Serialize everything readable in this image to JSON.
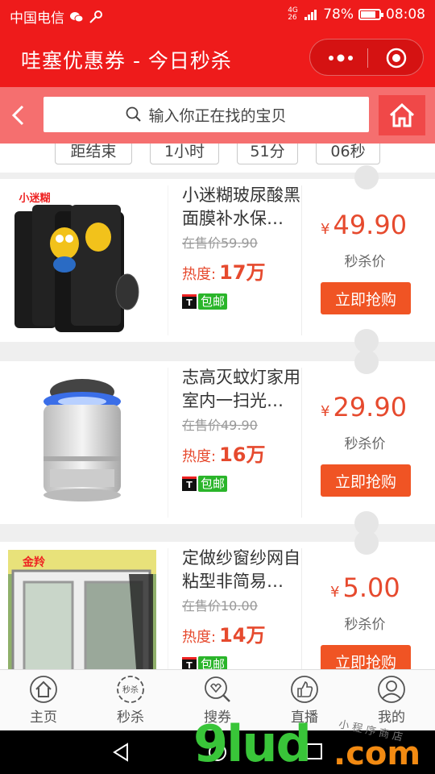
{
  "status_bar": {
    "carrier": "中国电信",
    "network": "4G 26",
    "battery": "78%",
    "time": "08:08"
  },
  "header": {
    "title": "哇塞优惠券 - 今日秒杀"
  },
  "search": {
    "placeholder": "输入你正在找的宝贝"
  },
  "countdown": {
    "label": "距结束",
    "hours": "1小时",
    "minutes": "51分",
    "seconds": "06秒"
  },
  "products": [
    {
      "name": "小迷糊玻尿酸黑面膜补水保…",
      "original_price": "在售价59.90",
      "heat_label": "热度:",
      "heat": "17万",
      "shipping": "包邮",
      "currency": "¥",
      "price": "49.90",
      "price_label": "秒杀价",
      "buy_label": "立即抢购"
    },
    {
      "name": "志高灭蚊灯家用室内一扫光…",
      "original_price": "在售价49.90",
      "heat_label": "热度:",
      "heat": "16万",
      "shipping": "包邮",
      "currency": "¥",
      "price": "29.90",
      "price_label": "秒杀价",
      "buy_label": "立即抢购"
    },
    {
      "name": "定做纱窗纱网自粘型非简易…",
      "original_price": "在售价10.00",
      "heat_label": "热度:",
      "heat": "14万",
      "shipping": "包邮",
      "currency": "¥",
      "price": "5.00",
      "price_label": "秒杀价",
      "buy_label": "立即抢购"
    }
  ],
  "product_images": {
    "p1_brand": "小迷糊",
    "p3_brand": "金羚"
  },
  "tabs": [
    {
      "label": "主页",
      "icon": "home-icon"
    },
    {
      "label": "秒杀",
      "icon": "flash-sale-icon",
      "icon_text": "秒杀"
    },
    {
      "label": "搜券",
      "icon": "search-coupon-icon"
    },
    {
      "label": "直播",
      "icon": "thumbs-up-icon"
    },
    {
      "label": "我的",
      "icon": "user-icon"
    }
  ],
  "watermark": {
    "main": "9lud",
    "suffix": ".com",
    "small": "小程序商店"
  },
  "colors": {
    "primary": "#ee1b1b",
    "accent": "#f05424",
    "price": "#e64a2e",
    "free_ship": "#2ab52a"
  }
}
